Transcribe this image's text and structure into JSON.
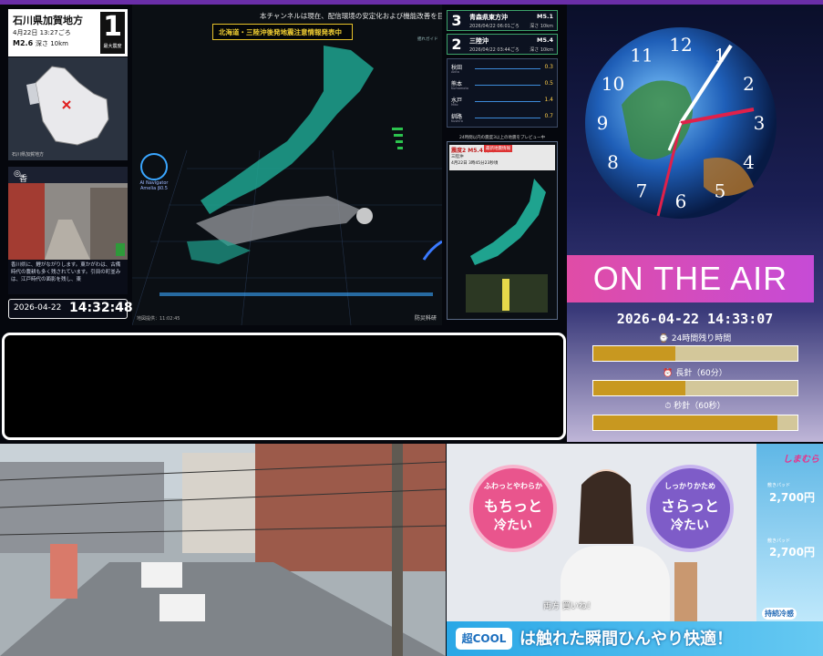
{
  "colors": {
    "accent_purple": "#6a2ea8",
    "alert_yellow": "#f2cf33",
    "onair_pink": "#e04ca6",
    "progress_gold": "#c89820"
  },
  "info": {
    "region": "石川県加賀地方",
    "time": "4月22日 13:27ごろ",
    "magnitude": "M2.6",
    "depth": "深さ 10km",
    "intensity": "1",
    "intensity_label": "最大震度"
  },
  "minimap": {
    "caption": "石川県加賀地方"
  },
  "camera": {
    "label": "香川県 東かがわ市",
    "description": "香川県に、鯉がながりします。東かがわは、古備時代の農耕も多く残されています。引田の町並みは、江戸時代の面影を残し、東"
  },
  "left_clock": {
    "date": "2026-04-22",
    "time": "14:32:48"
  },
  "map": {
    "notice": "本チャンネルは現在、配信環境の安定化および機能改善を目",
    "alert": "北海道・三陸沖後発地震注意情報発表中",
    "ai_navigator": "AI Navigator Amelia β0.5",
    "footer_left": "地図提供：11:02:45",
    "footer_right": "防災科研"
  },
  "quakes": [
    {
      "num": "3",
      "place": "青森県東方沖",
      "time": "2026/04/22 06:01ごろ",
      "mag": "M5.1",
      "depth": "深さ 10km"
    },
    {
      "num": "2",
      "place": "三陸沖",
      "time": "2026/04/22 03:44ごろ",
      "mag": "M5.4",
      "depth": "深さ 10km"
    }
  ],
  "guide": "揺れガイド",
  "sensors": [
    {
      "name": "秋田",
      "sub": "Akita",
      "value": "0.3"
    },
    {
      "name": "熊本",
      "sub": "Kumamoto",
      "value": "0.5"
    },
    {
      "name": "水戸",
      "sub": "Mito",
      "value": "1.4"
    },
    {
      "name": "釧路",
      "sub": "Kushiro",
      "value": "0.7"
    }
  ],
  "preview": {
    "title": "24時間以内の震度3以上の地震をプレビュー中",
    "tag": "最新地震情報",
    "headline": "震度2 M5.4 深さ10km",
    "place": "三陸沖",
    "time": "4月22日 3時45分23秒頃"
  },
  "right": {
    "on_air": "ON THE AIR",
    "datetime": "2026-04-22 14:33:07",
    "progress": [
      {
        "label": "24時間残り時間",
        "fraction": 0.4
      },
      {
        "label": "長針（60分）",
        "fraction": 0.45
      },
      {
        "label": "秒針（60秒）",
        "fraction": 0.9
      }
    ]
  },
  "clock": {
    "hours": [
      "12",
      "1",
      "2",
      "3",
      "4",
      "5",
      "6",
      "7",
      "8",
      "9",
      "10",
      "11"
    ]
  },
  "ad": {
    "bubble1_top": "ふわっとやわらか",
    "bubble1_main": "もちっと",
    "bubble1_sub": "冷たい",
    "bubble2_top": "しっかりかため",
    "bubble2_main": "さらっと",
    "bubble2_sub": "冷たい",
    "brand": "しまむら",
    "price_label1": "敷きパッド",
    "price1": "2,700円",
    "price_label2": "敷きパッド",
    "price2": "2,700円",
    "side_tag": "持続冷感",
    "caption": "両方 買いね！",
    "logo": "超COOL",
    "banner": "は触れた瞬間ひんやり快適！"
  }
}
